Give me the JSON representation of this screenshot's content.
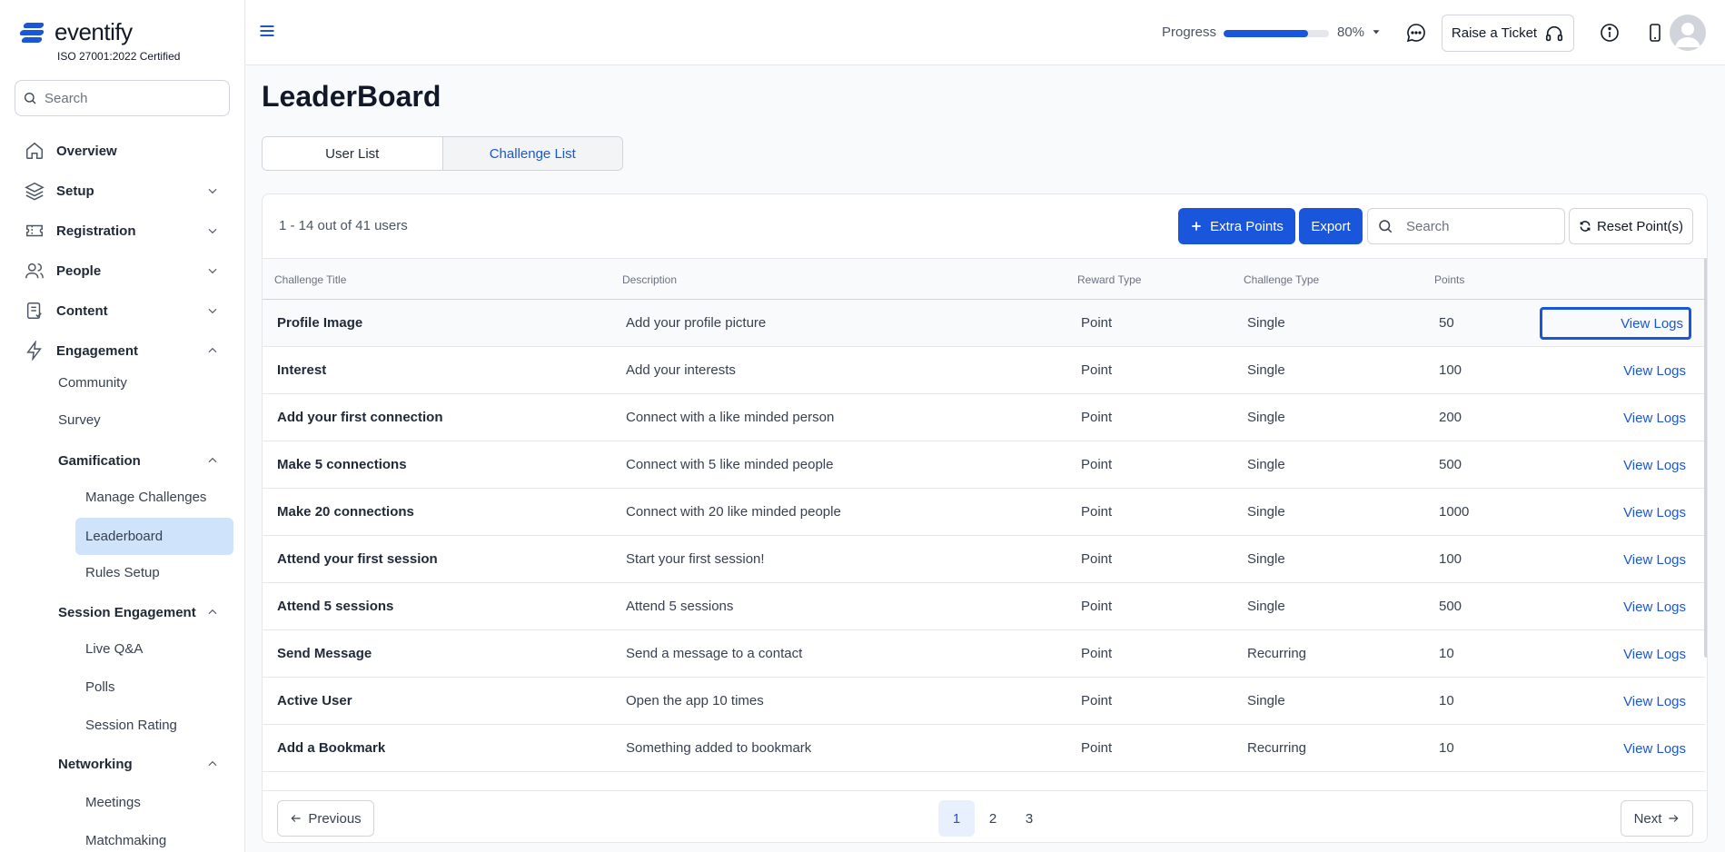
{
  "brand": {
    "name": "eventify",
    "certification": "ISO 27001:2022 Certified",
    "accent_color": "#1a56db"
  },
  "sidebar": {
    "search_placeholder": "Search",
    "nav": [
      {
        "label": "Overview",
        "icon": "home-icon"
      },
      {
        "label": "Setup",
        "icon": "layers-icon"
      },
      {
        "label": "Registration",
        "icon": "ticket-icon"
      },
      {
        "label": "People",
        "icon": "users-icon"
      },
      {
        "label": "Content",
        "icon": "document-icon"
      },
      {
        "label": "Engagement",
        "icon": "lightning-icon"
      }
    ],
    "engagement_items": {
      "community": "Community",
      "survey": "Survey",
      "gamification": "Gamification",
      "manage_challenges": "Manage Challenges",
      "leaderboard": "Leaderboard",
      "rules_setup": "Rules Setup",
      "session_engagement": "Session Engagement",
      "live_qa": "Live Q&A",
      "polls": "Polls",
      "session_rating": "Session Rating",
      "networking": "Networking",
      "meetings": "Meetings",
      "matchmaking": "Matchmaking"
    }
  },
  "header": {
    "progress_label": "Progress",
    "progress_value": "80%",
    "progress_fraction": 0.8,
    "raise_ticket": "Raise a Ticket"
  },
  "main": {
    "title": "LeaderBoard",
    "tabs": {
      "user_list": "User List",
      "challenge_list": "Challenge List"
    },
    "count_text": "1 - 14 out of 41 users",
    "extra_points": "Extra Points",
    "export": "Export",
    "search_placeholder": "Search",
    "reset_points": "Reset Point(s)",
    "columns": {
      "challenge_title": "Challenge Title",
      "description": "Description",
      "reward_type": "Reward Type",
      "challenge_type": "Challenge Type",
      "points": "Points"
    },
    "view_logs": "View Logs",
    "rows": [
      {
        "title": "Profile Image",
        "description": "Add your profile picture",
        "reward": "Point",
        "type": "Single",
        "points": "50"
      },
      {
        "title": "Interest",
        "description": "Add your interests",
        "reward": "Point",
        "type": "Single",
        "points": "100"
      },
      {
        "title": "Add your first connection",
        "description": "Connect with a like minded person",
        "reward": "Point",
        "type": "Single",
        "points": "200"
      },
      {
        "title": "Make 5 connections",
        "description": "Connect with 5 like minded people",
        "reward": "Point",
        "type": "Single",
        "points": "500"
      },
      {
        "title": "Make 20 connections",
        "description": "Connect with 20 like minded people",
        "reward": "Point",
        "type": "Single",
        "points": "1000"
      },
      {
        "title": "Attend your first session",
        "description": "Start your first session!",
        "reward": "Point",
        "type": "Single",
        "points": "100"
      },
      {
        "title": "Attend 5 sessions",
        "description": "Attend 5 sessions",
        "reward": "Point",
        "type": "Single",
        "points": "500"
      },
      {
        "title": "Send Message",
        "description": "Send a message to a contact",
        "reward": "Point",
        "type": "Recurring",
        "points": "10"
      },
      {
        "title": "Active User",
        "description": "Open the app 10 times",
        "reward": "Point",
        "type": "Single",
        "points": "10"
      },
      {
        "title": "Add a Bookmark",
        "description": "Something added to bookmark",
        "reward": "Point",
        "type": "Recurring",
        "points": "10"
      }
    ],
    "pagination": {
      "previous": "Previous",
      "next": "Next",
      "pages": [
        "1",
        "2",
        "3"
      ],
      "current": "1"
    }
  }
}
